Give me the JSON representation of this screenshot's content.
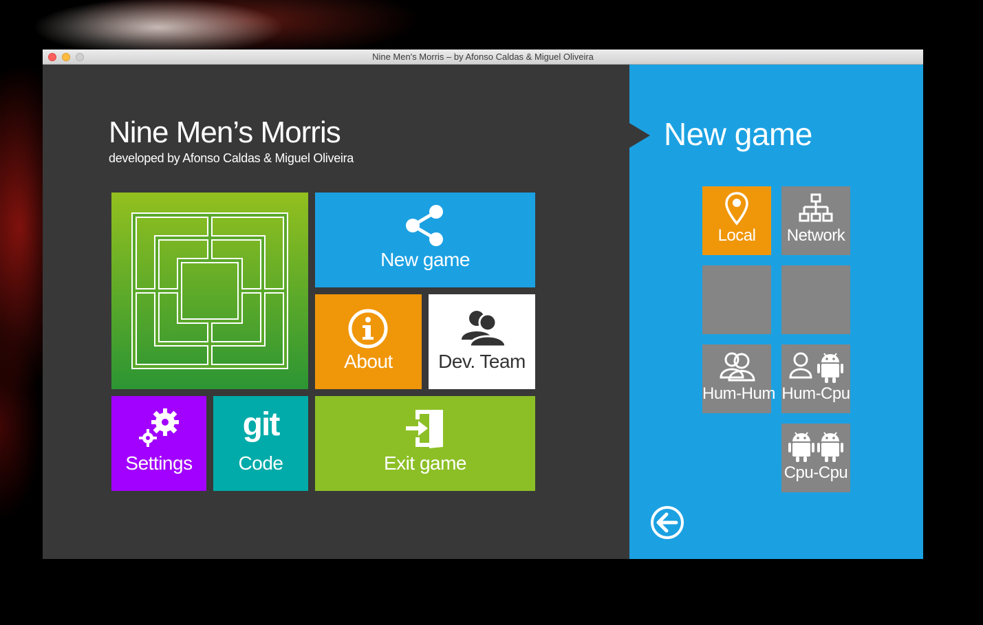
{
  "window": {
    "title": "Nine Men's Morris – by Afonso Caldas & Miguel Oliveira"
  },
  "app": {
    "title": "Nine Men’s Morris",
    "subtitle": "developed by Afonso Caldas & Miguel Oliveira"
  },
  "tiles": {
    "board": {
      "icon": "morris-board-icon",
      "color": "#8cbf26"
    },
    "new_game": {
      "label": "New game",
      "icon": "share-icon",
      "color": "#1ba1e2"
    },
    "about": {
      "label": "About",
      "icon": "info-icon",
      "color": "#f09609"
    },
    "dev_team": {
      "label": "Dev. Team",
      "icon": "people-icon",
      "color": "#ffffff"
    },
    "settings": {
      "label": "Settings",
      "icon": "gears-icon",
      "color": "#a200ff"
    },
    "code": {
      "label": "Code",
      "icon_text": "git",
      "icon": "git-icon",
      "color": "#00aba9"
    },
    "exit": {
      "label": "Exit game",
      "icon": "exit-door-icon",
      "color": "#8cbf26"
    }
  },
  "side_panel": {
    "title": "New game",
    "color": "#1ba1e2",
    "options": {
      "local": {
        "label": "Local",
        "icon": "map-pin-icon",
        "selected": true,
        "color": "#f09609"
      },
      "network": {
        "label": "Network",
        "icon": "network-icon",
        "color": "#858585"
      },
      "hum_hum": {
        "label": "Hum-Hum",
        "icon": "two-humans-icon"
      },
      "hum_cpu": {
        "label": "Hum-Cpu",
        "icon": "human-android-icon"
      },
      "cpu_cpu": {
        "label": "Cpu-Cpu",
        "icon": "two-androids-icon"
      }
    },
    "back_icon": "back-arrow-icon"
  }
}
